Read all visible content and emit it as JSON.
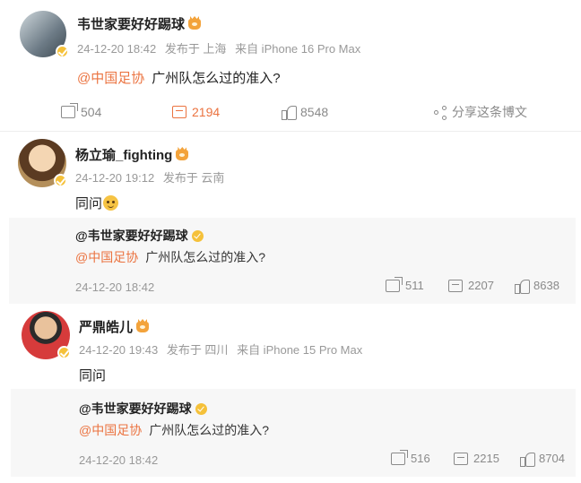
{
  "post": {
    "author": "韦世家要好好踢球",
    "time": "24-12-20 18:42",
    "location": "发布于 上海",
    "device": "来自 iPhone 16 Pro Max",
    "mention": "@中国足协",
    "text": "广州队怎么过的准入?",
    "reposts": "504",
    "comments": "2194",
    "likes": "8548",
    "share_label": "分享这条博文"
  },
  "comments": [
    {
      "author": "杨立瑜_fighting",
      "time": "24-12-20 19:12",
      "location": "发布于 云南",
      "device": "",
      "text": "同问",
      "quote": {
        "author": "@韦世家要好好踢球",
        "mention": "@中国足协",
        "text": "广州队怎么过的准入?",
        "time": "24-12-20 18:42",
        "reposts": "511",
        "comments": "2207",
        "likes": "8638"
      }
    },
    {
      "author": "严鼎皓儿",
      "time": "24-12-20 19:43",
      "location": "发布于 四川",
      "device": "来自 iPhone 15 Pro Max",
      "text": "同问",
      "quote": {
        "author": "@韦世家要好好踢球",
        "mention": "@中国足协",
        "text": "广州队怎么过的准入?",
        "time": "24-12-20 18:42",
        "reposts": "516",
        "comments": "2215",
        "likes": "8704"
      }
    }
  ],
  "colors": {
    "accent": "#eb7340",
    "muted": "#999999",
    "quote_bg": "#f7f7f7",
    "verified": "#f5c13a"
  },
  "icons": [
    "repost-icon",
    "comment-icon",
    "like-icon",
    "share-icon",
    "crown-icon",
    "verified-icon",
    "smile-emoji"
  ]
}
